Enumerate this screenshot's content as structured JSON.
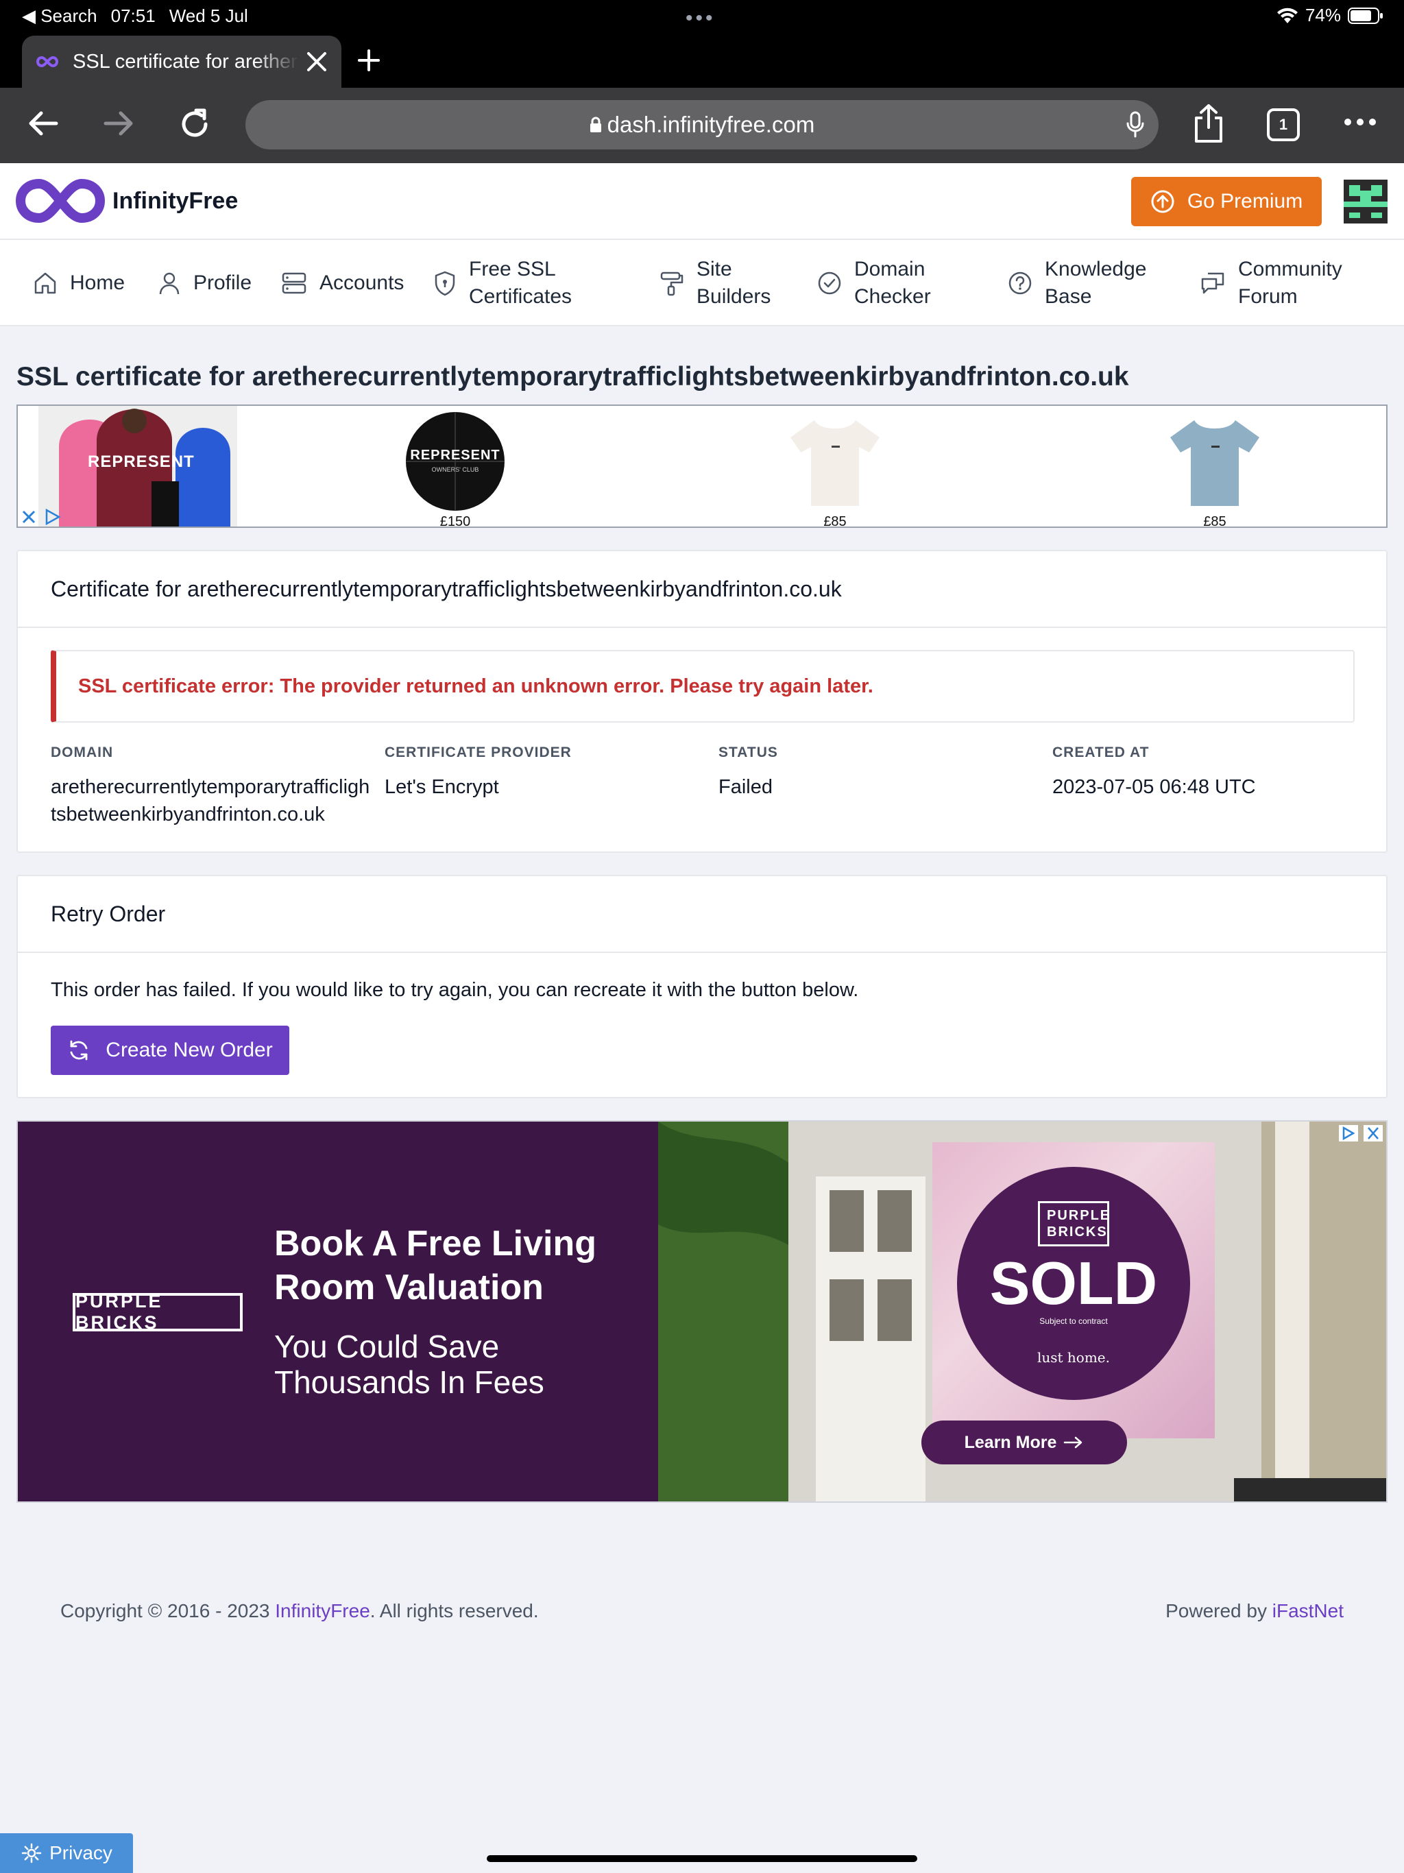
{
  "status_bar": {
    "back_app": "◀ Search",
    "time": "07:51",
    "date": "Wed 5 Jul",
    "battery": "74%"
  },
  "browser": {
    "tab_title": "SSL certificate for aretherecurrentlytemporarytrafficlightsbetweenkirbyandfrinton.co.uk",
    "url": "dash.infinityfree.com",
    "tabs_count": "1"
  },
  "header": {
    "brand": "InfinityFree",
    "premium_button": "Go Premium"
  },
  "nav": [
    {
      "label": "Home",
      "icon": "home-icon"
    },
    {
      "label": "Profile",
      "icon": "user-icon"
    },
    {
      "label": "Accounts",
      "icon": "server-icon"
    },
    {
      "label": "Free SSL\nCertificates",
      "icon": "shield-icon"
    },
    {
      "label": "Site\nBuilders",
      "icon": "paint-roller-icon"
    },
    {
      "label": "Domain\nChecker",
      "icon": "check-circle-icon"
    },
    {
      "label": "Knowledge\nBase",
      "icon": "question-circle-icon"
    },
    {
      "label": "Community\nForum",
      "icon": "chat-icon"
    }
  ],
  "page_title": "SSL certificate for aretherecurrentlytemporarytrafficlightsbetweenkirbyandfrinton.co.uk",
  "ad_top": {
    "brand_text": "REPRESENT",
    "ball_text": "REPRESENT",
    "ball_sub": "OWNERS' CLUB",
    "prices": [
      "£150",
      "£85",
      "£85"
    ]
  },
  "certificate_card": {
    "title": "Certificate for aretherecurrentlytemporarytrafficlightsbetweenkirbyandfrinton.co.uk",
    "error": "SSL certificate error: The provider returned an unknown error. Please try again later.",
    "details": {
      "domain_label": "DOMAIN",
      "domain_value": "aretherecurrentlytemporarytrafficlightsbetweenkirbyandfrinton.co.uk",
      "provider_label": "CERTIFICATE PROVIDER",
      "provider_value": "Let's Encrypt",
      "status_label": "STATUS",
      "status_value": "Failed",
      "created_label": "CREATED AT",
      "created_value": "2023-07-05 06:48 UTC"
    }
  },
  "retry_card": {
    "title": "Retry Order",
    "text": "This order has failed. If you would like to try again, you can recreate it with the button below.",
    "button": "Create New Order"
  },
  "ad_banner": {
    "brand": "PURPLE BRICKS",
    "headline": "Book A Free Living Room Valuation",
    "subline": "You Could Save Thousands In Fees",
    "sign_brand": "PURPLE BRICKS",
    "sign_text": "SOLD",
    "sign_small": "Subject to contract",
    "sign_partner": "lust home.",
    "cta": "Learn More"
  },
  "footer": {
    "copyright_prefix": "Copyright © 2016 - 2023 ",
    "copyright_link": "InfinityFree",
    "copyright_suffix": ". All rights reserved.",
    "powered_prefix": "Powered by ",
    "powered_link": "iFastNet"
  },
  "privacy_button": "Privacy",
  "colors": {
    "brand_purple": "#6b3fc4",
    "premium_orange": "#e8721c",
    "error_red": "#c53030",
    "ad_purple": "#3c1644"
  }
}
